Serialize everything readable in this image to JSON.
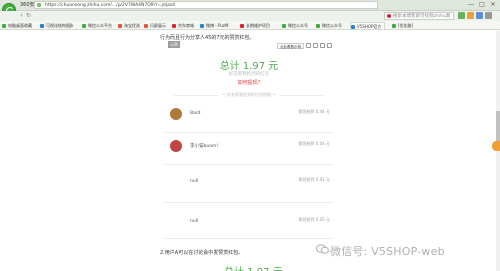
{
  "window": {
    "title": "360安全浏览器 9.1",
    "controls": [
      "—",
      "□",
      "✕"
    ]
  },
  "address": {
    "url": "https://chuansong.zhihu.com/.../p/2V7WA4N7Q9?r=jdjaz4",
    "search_placeholder": "搜索本博客即可找到zhihu源"
  },
  "bookmarks": [
    {
      "label": "电脑桌面收藏",
      "color": "#3fae3a"
    },
    {
      "label": "可视化结构图Jk",
      "color": "#2f7fd3"
    },
    {
      "label": "微信公众平台",
      "color": "#3fae3a"
    },
    {
      "label": "淘宝优选",
      "color": "#e6553a"
    },
    {
      "label": "闪屏展示",
      "color": "#e6553a"
    },
    {
      "label": "京东商城",
      "color": "#d23"
    },
    {
      "label": "微博 - PuzM",
      "color": "#2f7fd3"
    },
    {
      "label": "长期维护项目",
      "color": "#d23"
    },
    {
      "label": "微信公众号",
      "color": "#3fae3a"
    },
    {
      "label": "微信公众号",
      "color": "#3fae3a"
    },
    {
      "label": "V5SHOP官方",
      "color": "#2f7fd3",
      "active": true
    },
    {
      "label": "[优化路]",
      "color": "#3fae3a"
    }
  ],
  "page": {
    "intro": "行为而且行为分享人45的7元的赞赏红包。",
    "intro2": "2.用户A可以在讨论会中发赞赏红包。",
    "card": {
      "tag": "示例",
      "tool_label": "点此看看示例",
      "total": "总计 1.97 元",
      "subhint": "好友帮我抢到的红包",
      "withdraw": "如何提现?",
      "records_label": "— 好友帮我抢到的红包明细 —",
      "rows": [
        {
          "name": "Bard",
          "amount": "帮您抢到 0.44 元",
          "avatar_color": "#b07a3a"
        },
        {
          "name": "李小猫boom!",
          "amount": "帮您抢到 0.04 元",
          "avatar_color": "#c04545"
        },
        {
          "name": "null",
          "amount": "帮您抢到 0.01 元",
          "avatar_color": "#ffffff"
        },
        {
          "name": "null",
          "amount": "帮您抢到 0.05 元",
          "avatar_color": "#ffffff"
        }
      ]
    },
    "next_total": "总计 1.97 元",
    "watermark": "微信号: V5SHOP-web"
  }
}
